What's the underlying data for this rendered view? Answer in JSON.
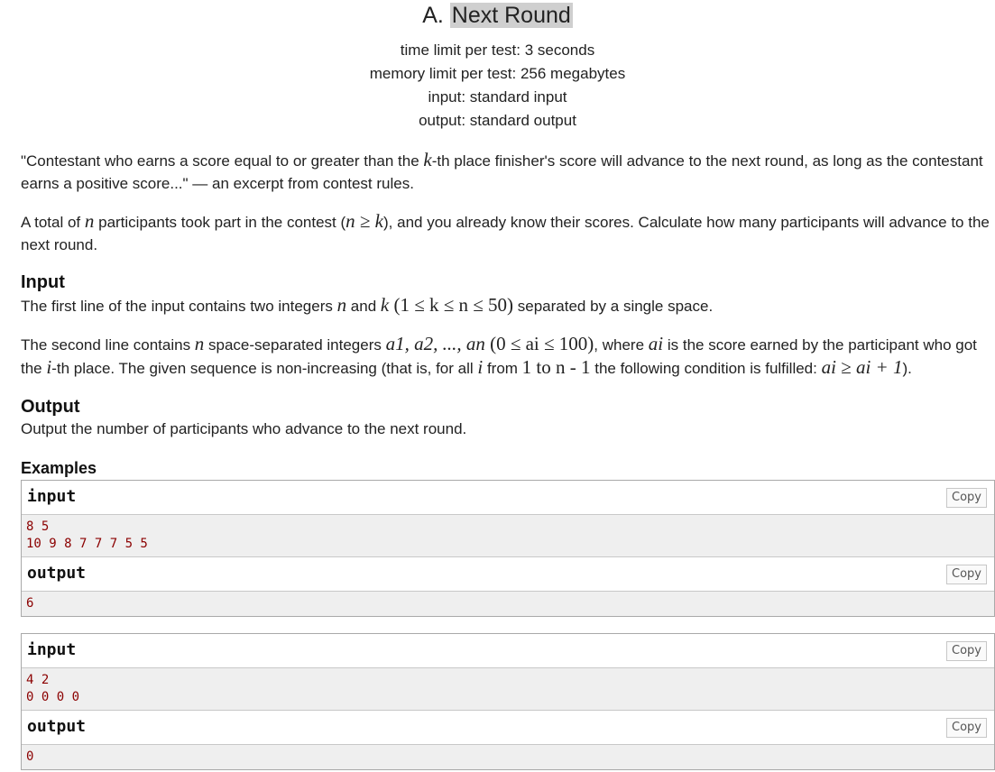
{
  "problem": {
    "index": "A.",
    "name": "Next Round",
    "time_limit": "time limit per test: 3 seconds",
    "memory_limit": "memory limit per test: 256 megabytes",
    "input_src": "input: standard input",
    "output_src": "output: standard output"
  },
  "statement": {
    "p1a": "\"Contestant who earns a score equal to or greater than the ",
    "p1k": "k",
    "p1b": "-th place finisher's score will advance to the next round, as long as the contestant earns a positive score...\" — an excerpt from contest rules.",
    "p2a": "A total of ",
    "p2n": "n",
    "p2b": " participants took part in the contest (",
    "p2c": "n ≥ k",
    "p2d": "), and you already know their scores. Calculate how many participants will advance to the next round."
  },
  "input_section": {
    "title": "Input",
    "l1a": "The first line of the input contains two integers ",
    "l1n": "n",
    "l1and": " and ",
    "l1k": "k",
    "l1c": " (1 ≤ k ≤ n ≤ 50)",
    "l1d": " separated by a single space.",
    "l2a": "The second line contains ",
    "l2n": "n",
    "l2b": " space-separated integers ",
    "l2seq": "a1, a2, ..., an",
    "l2c": " (0 ≤ ai ≤ 100)",
    "l2d": ", where ",
    "l2ai": "ai",
    "l2e": " is the score earned by the participant who got the ",
    "l2i": "i",
    "l2f": "-th place. The given sequence is non-increasing (that is, for all ",
    "l2i2": "i",
    "l2g": " from ",
    "l2range": "1 to n - 1",
    "l2h": " the following condition is fulfilled: ",
    "l2cond": "ai ≥ ai + 1",
    "l2end": ")."
  },
  "output_section": {
    "title": "Output",
    "text": "Output the number of participants who advance to the next round."
  },
  "examples": {
    "title": "Examples",
    "copy_label": "Copy",
    "input_label": "input",
    "output_label": "output",
    "ex1": {
      "input": [
        "8 5",
        "10 9 8 7 7 7 5 5"
      ],
      "output": [
        "6"
      ]
    },
    "ex2": {
      "input": [
        "4 2",
        "0 0 0 0"
      ],
      "output": [
        "0"
      ]
    }
  }
}
